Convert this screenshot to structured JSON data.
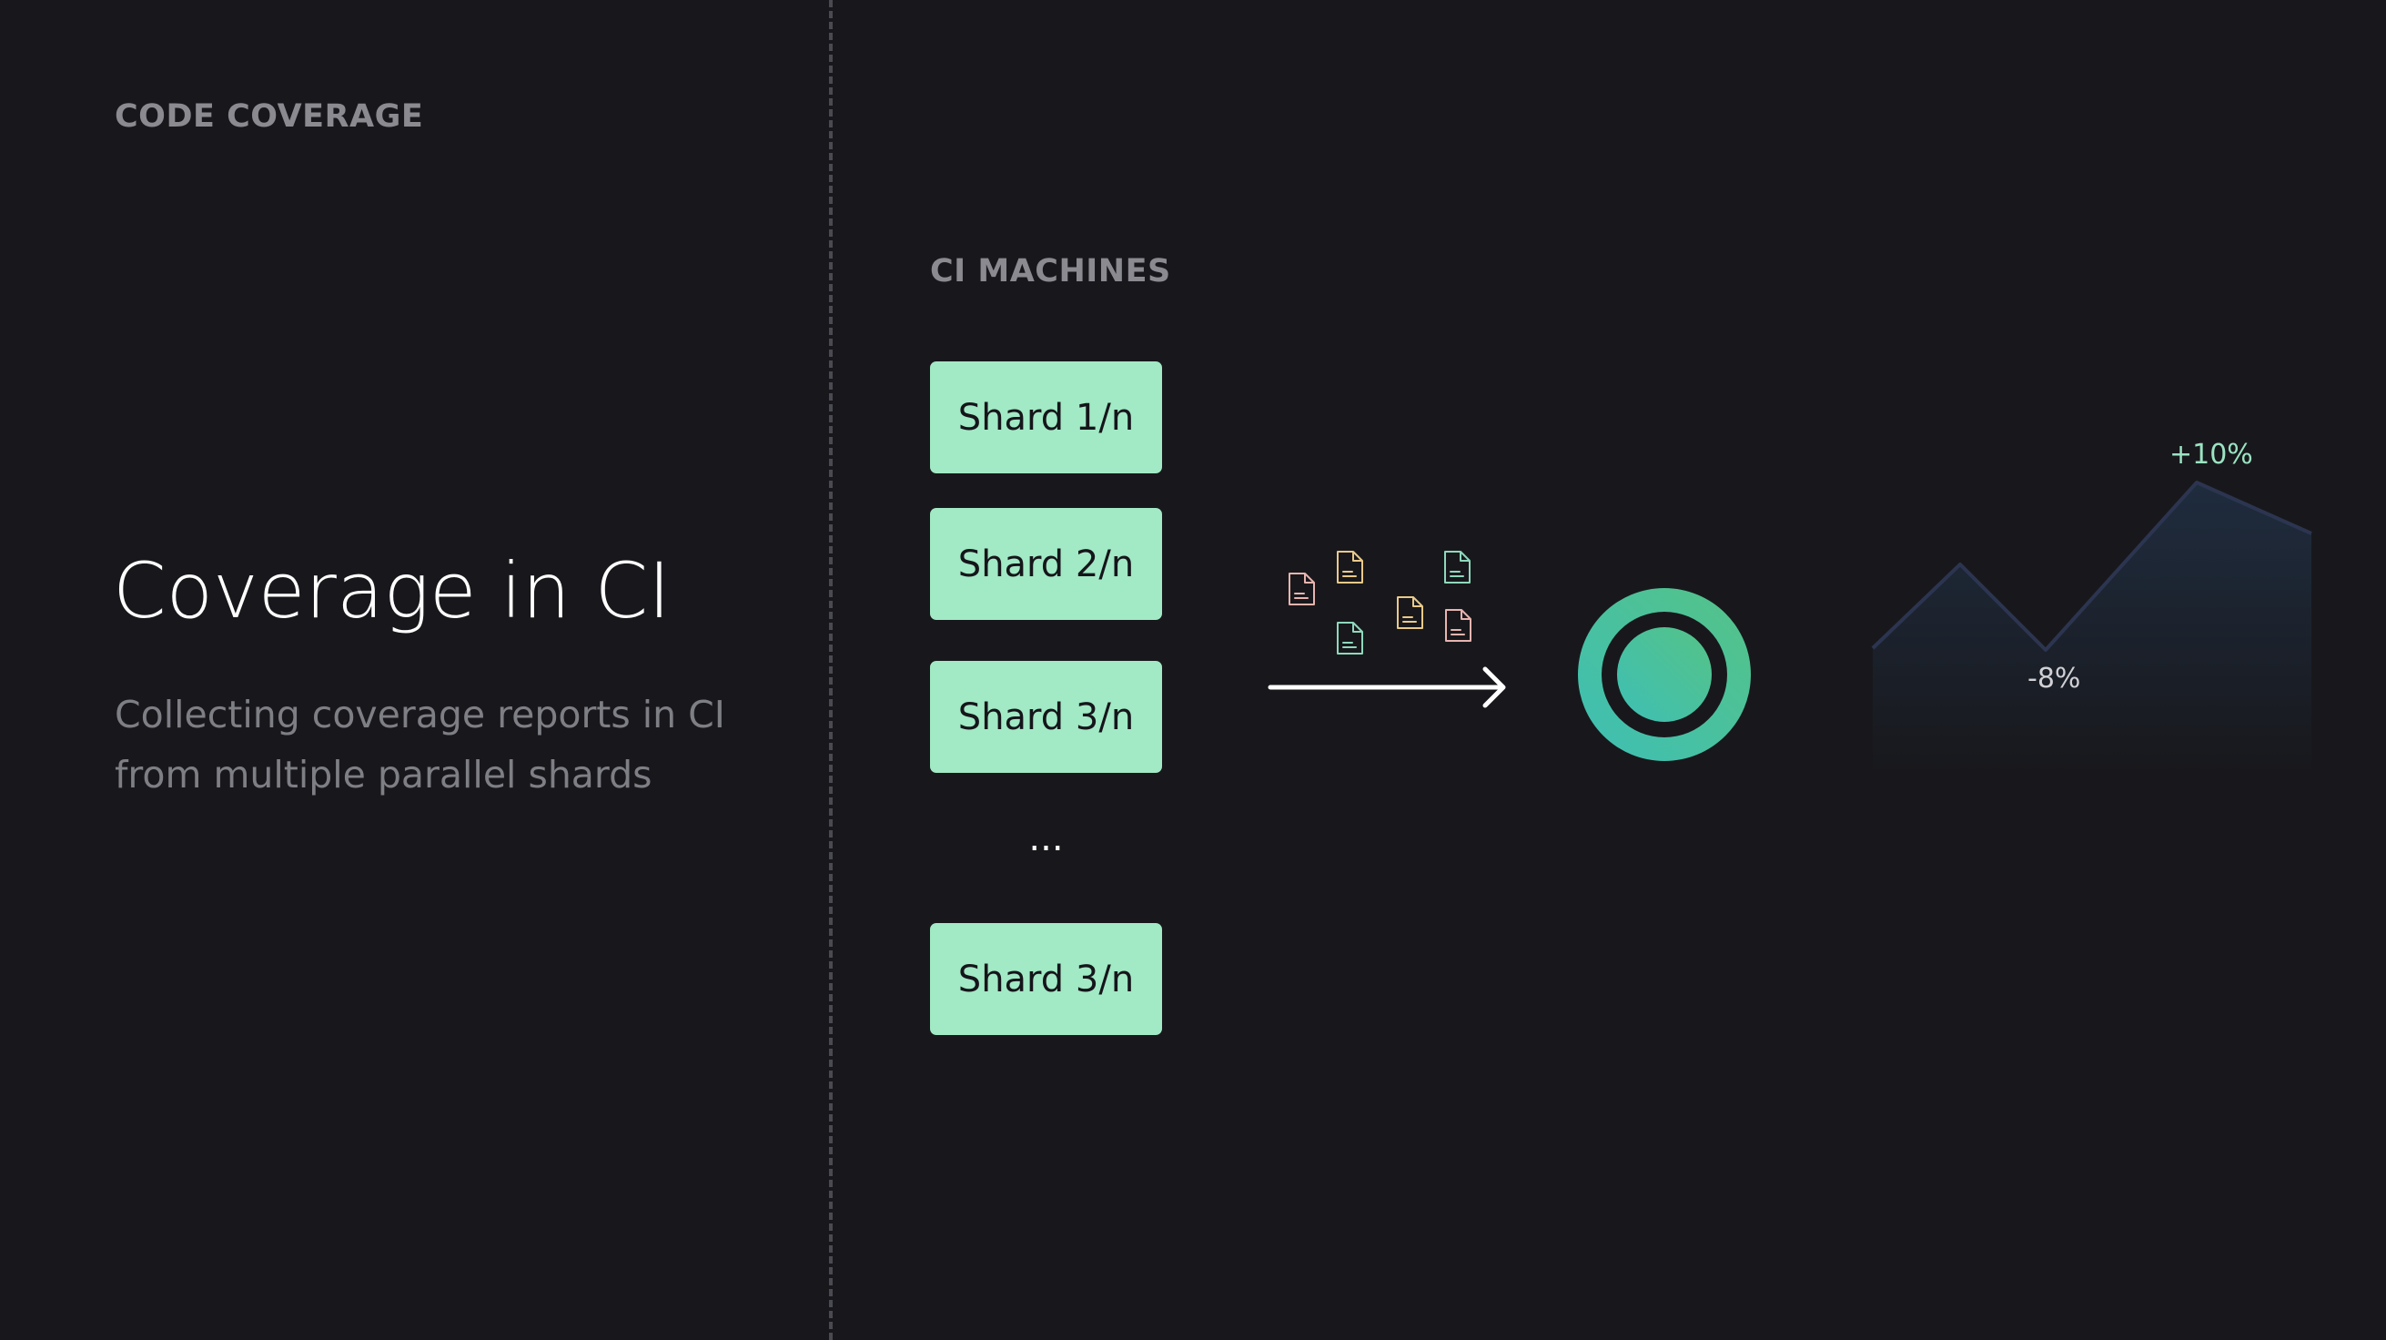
{
  "header": {
    "eyebrow": "CODE COVERAGE"
  },
  "hero": {
    "title": "Coverage in CI",
    "subtitle": "Collecting coverage reports in CI from multiple parallel shards"
  },
  "machines": {
    "label": "CI MACHINES",
    "shards": [
      "Shard 1/n",
      "Shard 2/n",
      "Shard 3/n"
    ],
    "ellipsis": "...",
    "last_shard": "Shard 3/n"
  },
  "report_files": [
    {
      "icon": "document-icon",
      "color": "#e8b4b0"
    },
    {
      "icon": "document-icon",
      "color": "#e9c98a"
    },
    {
      "icon": "document-icon",
      "color": "#8fd8bc"
    },
    {
      "icon": "document-icon",
      "color": "#e9c98a"
    },
    {
      "icon": "document-icon",
      "color": "#8fd8bc"
    },
    {
      "icon": "document-icon",
      "color": "#e8b4b0"
    }
  ],
  "trend": {
    "peak_label": "+10%",
    "dip_label": "-8%",
    "colors": {
      "positive": "#9be3c2",
      "negative": "#d0d0d5",
      "line": "#2c3550"
    }
  },
  "colors": {
    "background": "#18181c",
    "shard_fill": "#a2e9c5",
    "ring_gradient": [
      "#3ec0b5",
      "#55c287"
    ],
    "arrow": "#ffffff"
  }
}
